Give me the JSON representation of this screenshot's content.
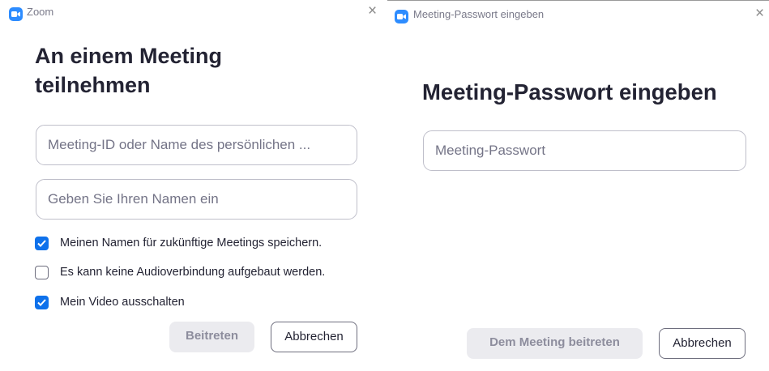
{
  "join_dialog": {
    "window_title": "Zoom",
    "close_symbol": "×",
    "heading_line1": "An einem Meeting",
    "heading_line2": "teilnehmen",
    "meeting_id_placeholder": "Meeting-ID oder Name des persönlichen ...",
    "name_placeholder": "Geben Sie Ihren Namen ein",
    "options": [
      {
        "label": "Meinen Namen für zukünftige Meetings speichern.",
        "checked": true
      },
      {
        "label": "Es kann keine Audioverbindung aufgebaut werden.",
        "checked": false
      },
      {
        "label": "Mein Video ausschalten",
        "checked": true
      }
    ],
    "join_button": "Beitreten",
    "cancel_button": "Abbrechen"
  },
  "password_dialog": {
    "window_title": "Meeting-Passwort eingeben",
    "close_symbol": "×",
    "heading": "Meeting-Passwort eingeben",
    "password_placeholder": "Meeting-Passwort",
    "join_button": "Dem Meeting beitreten",
    "cancel_button": "Abbrechen"
  },
  "colors": {
    "accent": "#0e71eb",
    "logo": "#2d8cff",
    "text": "#232333",
    "placeholder": "#747487",
    "disabled_button": "#ebebef"
  },
  "icons": {
    "app_logo": "zoom-camera-icon",
    "close": "close-icon",
    "checkbox_checked": "checkmark-icon"
  }
}
